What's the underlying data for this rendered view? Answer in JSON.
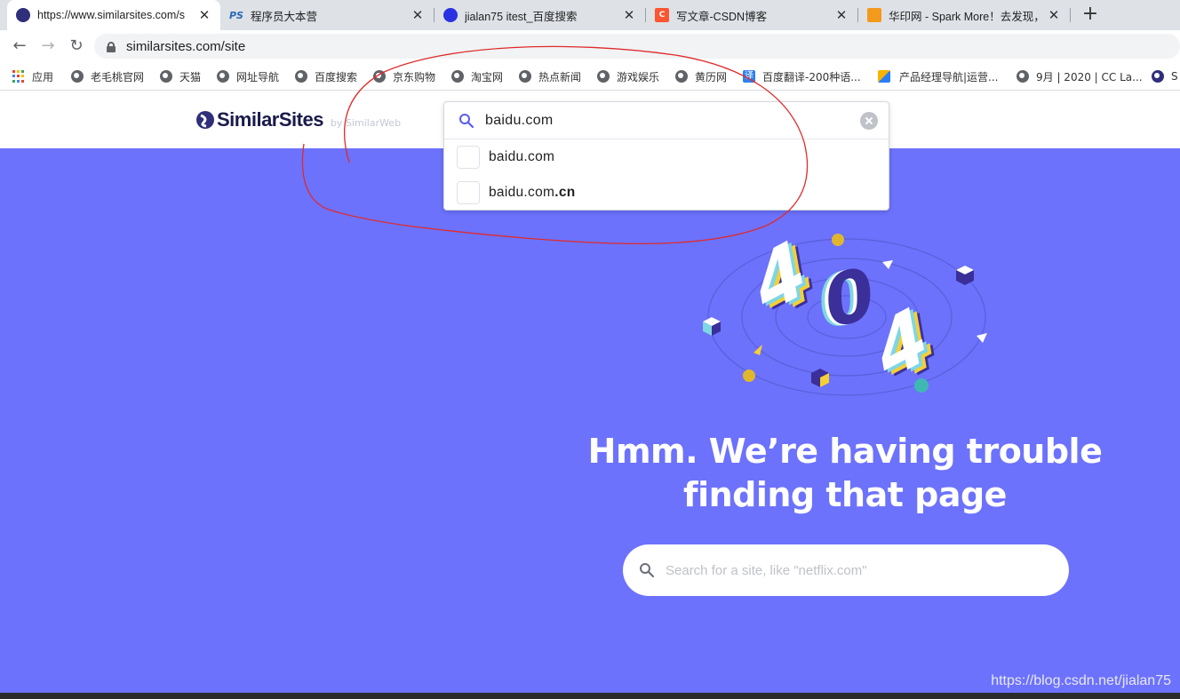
{
  "browser": {
    "tabs": [
      {
        "title": "https://www.similarsites.com/s",
        "active": true
      },
      {
        "title": "程序员大本营",
        "active": false
      },
      {
        "title": "jialan75 itest_百度搜索",
        "active": false
      },
      {
        "title": "写文章-CSDN博客",
        "active": false
      },
      {
        "title": "华印网 - Spark More！去发现，",
        "active": false
      }
    ],
    "favicons": [
      "similarsites",
      "PS",
      "baidu-paw",
      "C",
      "华印"
    ],
    "url": "similarsites.com/site",
    "bookmarks": [
      "应用",
      "老毛桃官网",
      "天猫",
      "网址导航",
      "百度搜索",
      "京东购物",
      "淘宝网",
      "热点新闻",
      "游戏娱乐",
      "黄历网",
      "百度翻译-200种语...",
      "产品经理导航|运营...",
      "9月 | 2020 | CC La...",
      "S"
    ],
    "translate_badge": "译"
  },
  "site": {
    "logo_name": "SimilarSites",
    "logo_by": "by SimilarWeb",
    "search": {
      "value": "baidu.com",
      "suggestions": [
        {
          "plain": "baidu.com",
          "bold": ""
        },
        {
          "plain": "baidu.com",
          "bold": ".cn"
        }
      ]
    },
    "illustration_text": [
      "4",
      "0",
      "4"
    ],
    "heading_line1": "Hmm. We’re having trouble",
    "heading_line2": "finding that page",
    "bottom_search_placeholder": "Search for a site, like \"netflix.com\""
  },
  "watermark": "https://blog.csdn.net/jialan75",
  "colors": {
    "page_bg": "#6c72fc",
    "brand_navy": "#1a1a4b",
    "accent_yellow": "#f5cf35",
    "accent_cyan": "#7fd6e4",
    "annotation_red": "#e02a2a"
  }
}
